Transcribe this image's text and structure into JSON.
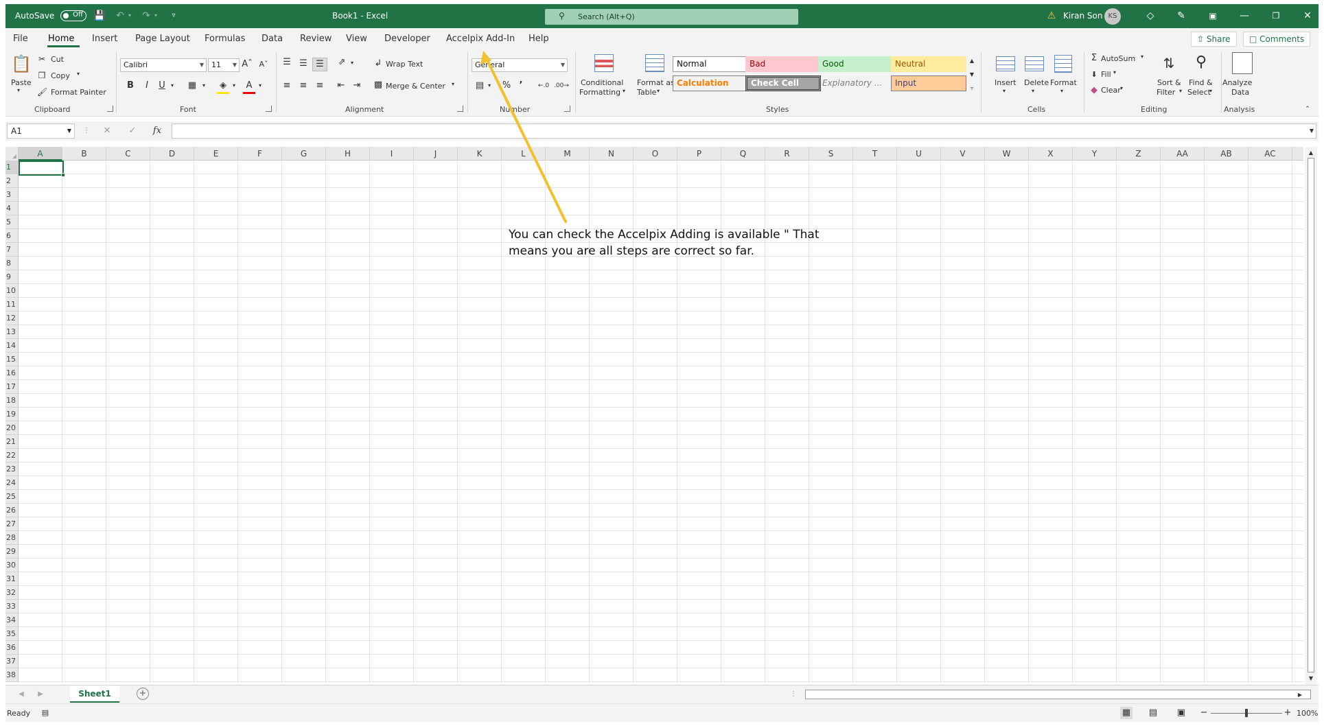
{
  "titlebar": {
    "autosave_label": "AutoSave",
    "autosave_state": "Off",
    "doc_title": "Book1  -  Excel",
    "search_placeholder": "Search (Alt+Q)",
    "user_name": "Kiran Son",
    "user_initials": "KS",
    "accent_color": "#217346"
  },
  "tabs": [
    "File",
    "Home",
    "Insert",
    "Page Layout",
    "Formulas",
    "Data",
    "Review",
    "View",
    "Developer",
    "Accelpix Add-In",
    "Help"
  ],
  "active_tab": "Home",
  "share_label": "Share",
  "comments_label": "Comments",
  "ribbon": {
    "clipboard": {
      "paste": "Paste",
      "cut": "Cut",
      "copy": "Copy",
      "format_painter": "Format Painter",
      "group": "Clipboard"
    },
    "font": {
      "family": "Calibri",
      "size": "11",
      "group": "Font",
      "bold": "B",
      "italic": "I",
      "underline": "U"
    },
    "alignment": {
      "wrap_text": "Wrap Text",
      "merge_center": "Merge & Center",
      "group": "Alignment"
    },
    "number": {
      "format": "General",
      "group": "Number"
    },
    "styles": {
      "conditional_formatting_l1": "Conditional",
      "conditional_formatting_l2": "Formatting",
      "format_as_table_l1": "Format as",
      "format_as_table_l2": "Table",
      "cells": [
        "Normal",
        "Bad",
        "Good",
        "Neutral",
        "Calculation",
        "Check Cell",
        "Explanatory ...",
        "Input"
      ],
      "group": "Styles"
    },
    "cells_group": {
      "insert": "Insert",
      "delete": "Delete",
      "format": "Format",
      "group": "Cells"
    },
    "editing": {
      "autosum": "AutoSum",
      "fill": "Fill",
      "clear": "Clear",
      "sort_filter_l1": "Sort &",
      "sort_filter_l2": "Filter",
      "find_select_l1": "Find &",
      "find_select_l2": "Select",
      "group": "Editing"
    },
    "analysis": {
      "analyze_data_l1": "Analyze",
      "analyze_data_l2": "Data",
      "group": "Analysis"
    }
  },
  "formula_bar": {
    "name_box": "A1",
    "fx": "fx",
    "value": ""
  },
  "columns": [
    "A",
    "B",
    "C",
    "D",
    "E",
    "F",
    "G",
    "H",
    "I",
    "J",
    "K",
    "L",
    "M",
    "N",
    "O",
    "P",
    "Q",
    "R",
    "S",
    "T",
    "U",
    "V",
    "W",
    "X",
    "Y",
    "Z",
    "AA",
    "AB",
    "AC"
  ],
  "rows": [
    "1",
    "2",
    "3",
    "4",
    "5",
    "6",
    "7",
    "8",
    "9",
    "10",
    "11",
    "12",
    "13",
    "14",
    "15",
    "16",
    "17",
    "18",
    "19",
    "20",
    "21",
    "22",
    "23",
    "24",
    "25",
    "26",
    "27",
    "28",
    "29",
    "30",
    "31",
    "32",
    "33",
    "34",
    "35",
    "36",
    "37",
    "38"
  ],
  "annotation": "You can check the Accelpix Adding is available \" That\nmeans you are all steps are correct so far.",
  "sheet_tabs": [
    "Sheet1"
  ],
  "status": {
    "ready": "Ready",
    "zoom": "100%"
  }
}
